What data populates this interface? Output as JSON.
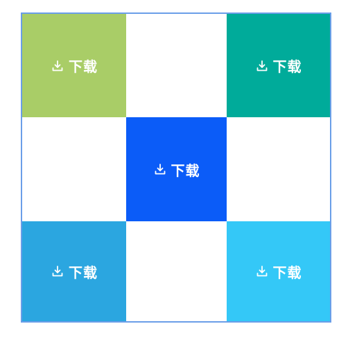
{
  "tiles": [
    {
      "label": "下载",
      "color": "#a9cd67",
      "filled": true
    },
    {
      "label": "",
      "color": "#ffffff",
      "filled": false
    },
    {
      "label": "下载",
      "color": "#00ab9a",
      "filled": true
    },
    {
      "label": "",
      "color": "#ffffff",
      "filled": false
    },
    {
      "label": "下载",
      "color": "#0b5cf8",
      "filled": true
    },
    {
      "label": "",
      "color": "#ffffff",
      "filled": false
    },
    {
      "label": "下载",
      "color": "#2ba6e0",
      "filled": true
    },
    {
      "label": "",
      "color": "#ffffff",
      "filled": false
    },
    {
      "label": "下载",
      "color": "#34c8f7",
      "filled": true
    }
  ],
  "icon": "download-icon",
  "frame_color": "#6a9ee8"
}
